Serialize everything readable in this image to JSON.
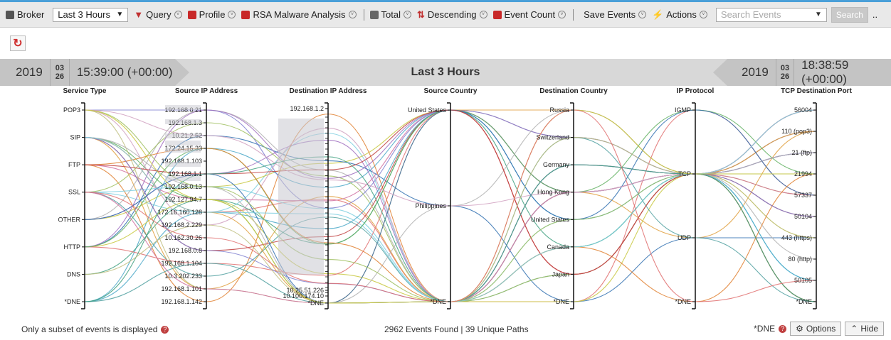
{
  "toolbar": {
    "broker": "Broker",
    "time_select": "Last 3 Hours",
    "query": "Query",
    "profile": "Profile",
    "analysis": "RSA Malware Analysis",
    "total": "Total",
    "descending": "Descending",
    "event_count": "Event Count",
    "save_events": "Save Events",
    "actions": "Actions",
    "search_placeholder": "Search Events",
    "search_button": "Search",
    "more": ".."
  },
  "timebar": {
    "start_year": "2019",
    "start_month": "03",
    "start_day": "26",
    "start_time": "15:39:00 (+00:00)",
    "title": "Last 3 Hours",
    "end_year": "2019",
    "end_month": "03",
    "end_day": "26",
    "end_time": "18:38:59 (+00:00)"
  },
  "axes": [
    {
      "title": "Service Type",
      "values": [
        "POP3",
        "SIP",
        "FTP",
        "SSL",
        "OTHER",
        "HTTP",
        "DNS",
        "*DNE"
      ]
    },
    {
      "title": "Source IP Address",
      "values": [
        "192.168.0.21",
        "192.168.1.3",
        "10.21.2.52",
        "172.24.15.33",
        "192.168.1.103",
        "192.168.1.1",
        "192.168.0.13",
        "192.127.94.7",
        "172.16.160.128",
        "192.168.2.229",
        "10.162.30.26",
        "192.168.0.8",
        "192.168.1.104",
        "10.3.202.233",
        "192.168.1.101",
        "192.168.1.142"
      ]
    },
    {
      "title": "Destination IP Address",
      "values": [
        "192.168.1.2",
        "10.25.51.226",
        "10.100.174.10",
        "*DNE"
      ]
    },
    {
      "title": "Source Country",
      "values": [
        "United States",
        "Philippines",
        "*DNE"
      ]
    },
    {
      "title": "Destination Country",
      "values": [
        "Russia",
        "Switzerland",
        "Germany",
        "Hong Kong",
        "United States",
        "Canada",
        "Japan",
        "*DNE"
      ]
    },
    {
      "title": "IP Protocol",
      "values": [
        "IGMP",
        "TCP",
        "UDP",
        "*DNE"
      ]
    },
    {
      "title": "TCP Destination Port",
      "values": [
        "56004",
        "110 (pop3)",
        "21 (ftp)",
        "21994",
        "57337",
        "50104",
        "443 (https)",
        "80 (http)",
        "50105",
        "*DNE"
      ]
    }
  ],
  "footer": {
    "subset_note": "Only a subset of events is displayed",
    "summary": "2962 Events Found | 39 Unique Paths",
    "dne_label": "*DNE",
    "options": "Options",
    "hide": "Hide"
  },
  "colors": {
    "accent": "#4a9fd8",
    "danger": "#d03030"
  }
}
